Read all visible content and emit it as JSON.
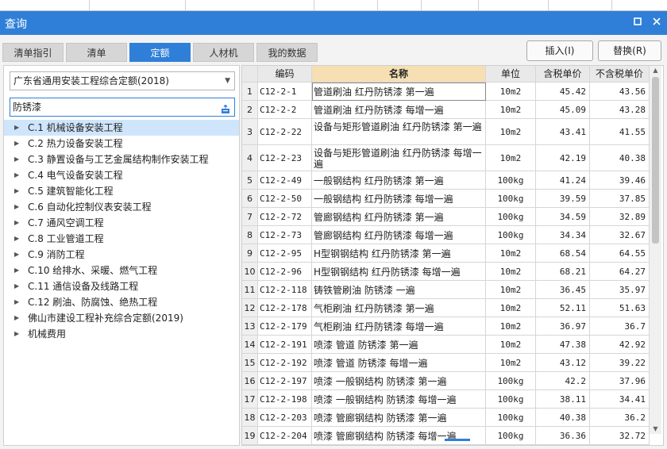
{
  "title": "查询",
  "tabs": [
    {
      "label": "清单指引",
      "active": false
    },
    {
      "label": "清单",
      "active": false
    },
    {
      "label": "定额",
      "active": true
    },
    {
      "label": "人材机",
      "active": false
    },
    {
      "label": "我的数据",
      "active": false
    }
  ],
  "buttons": {
    "insert": "插入(I)",
    "replace": "替换(R)"
  },
  "quota_library": {
    "selected": "广东省通用安装工程综合定额(2018)"
  },
  "search": {
    "value": "防锈漆"
  },
  "tree": [
    "C.1 机械设备安装工程",
    "C.2 热力设备安装工程",
    "C.3 静置设备与工艺金属结构制作安装工程",
    "C.4 电气设备安装工程",
    "C.5 建筑智能化工程",
    "C.6 自动化控制仪表安装工程",
    "C.7 通风空调工程",
    "C.8 工业管道工程",
    "C.9 消防工程",
    "C.10 给排水、采暖、燃气工程",
    "C.11 通信设备及线路工程",
    "C.12 刷油、防腐蚀、绝热工程",
    "佛山市建设工程补充综合定额(2019)",
    "机械费用"
  ],
  "table": {
    "headers": [
      "编码",
      "名称",
      "单位",
      "含税单价",
      "不含税单价"
    ],
    "rows": [
      [
        "1",
        "C12-2-1",
        "管道刷油 红丹防锈漆 第一遍",
        "10m2",
        "45.42",
        "43.56"
      ],
      [
        "2",
        "C12-2-2",
        "管道刷油 红丹防锈漆 每增一遍",
        "10m2",
        "45.09",
        "43.28"
      ],
      [
        "3",
        "C12-2-22",
        "设备与矩形管道刷油 红丹防锈漆 第一遍",
        "10m2",
        "43.41",
        "41.55"
      ],
      [
        "4",
        "C12-2-23",
        "设备与矩形管道刷油 红丹防锈漆 每增一遍",
        "10m2",
        "42.19",
        "40.38"
      ],
      [
        "5",
        "C12-2-49",
        "一般钢结构 红丹防锈漆 第一遍",
        "100kg",
        "41.24",
        "39.46"
      ],
      [
        "6",
        "C12-2-50",
        "一般钢结构 红丹防锈漆 每增一遍",
        "100kg",
        "39.59",
        "37.85"
      ],
      [
        "7",
        "C12-2-72",
        "管廊钢结构 红丹防锈漆 第一遍",
        "100kg",
        "34.59",
        "32.89"
      ],
      [
        "8",
        "C12-2-73",
        "管廊钢结构 红丹防锈漆 每增一遍",
        "100kg",
        "34.34",
        "32.67"
      ],
      [
        "9",
        "C12-2-95",
        "H型钢钢结构 红丹防锈漆 第一遍",
        "10m2",
        "68.54",
        "64.55"
      ],
      [
        "10",
        "C12-2-96",
        "H型钢钢结构 红丹防锈漆 每增一遍",
        "10m2",
        "68.21",
        "64.27"
      ],
      [
        "11",
        "C12-2-118",
        "铸铁管刷油 防锈漆 一遍",
        "10m2",
        "36.45",
        "35.97"
      ],
      [
        "12",
        "C12-2-178",
        "气柜刷油 红丹防锈漆 第一遍",
        "10m2",
        "52.11",
        "51.63"
      ],
      [
        "13",
        "C12-2-179",
        "气柜刷油 红丹防锈漆 每增一遍",
        "10m2",
        "36.97",
        "36.7"
      ],
      [
        "14",
        "C12-2-191",
        "喷漆 管道 防锈漆 第一遍",
        "10m2",
        "47.38",
        "42.92"
      ],
      [
        "15",
        "C12-2-192",
        "喷漆 管道 防锈漆 每增一遍",
        "10m2",
        "43.12",
        "39.22"
      ],
      [
        "16",
        "C12-2-197",
        "喷漆 一般钢结构 防锈漆 第一遍",
        "100kg",
        "42.2",
        "37.96"
      ],
      [
        "17",
        "C12-2-198",
        "喷漆 一般钢结构 防锈漆 每增一遍",
        "100kg",
        "38.11",
        "34.41"
      ],
      [
        "18",
        "C12-2-203",
        "喷漆 管廊钢结构 防锈漆 第一遍",
        "100kg",
        "40.38",
        "36.2"
      ],
      [
        "19",
        "C12-2-204",
        "喷漆 管廊钢结构 防锈漆 每增一遍",
        "100kg",
        "36.36",
        "32.72"
      ]
    ]
  },
  "colors": {
    "accent": "#2f7fd9",
    "name_header": "#f5dfb3",
    "selected_tree": "#cfe5fb"
  }
}
